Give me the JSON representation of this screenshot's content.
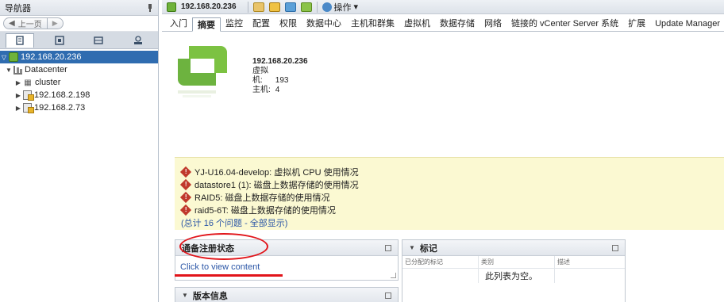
{
  "navigator": {
    "title": "导航器",
    "back_label": "上一页",
    "tree": {
      "root": "192.168.20.236",
      "datacenter": "Datacenter",
      "cluster": "cluster",
      "hosts": [
        "192.168.2.198",
        "192.168.2.73"
      ]
    }
  },
  "header": {
    "object": "192.168.20.236",
    "actions_label": "操作"
  },
  "tabs": [
    "入门",
    "摘要",
    "监控",
    "配置",
    "权限",
    "数据中心",
    "主机和群集",
    "虚拟机",
    "数据存储",
    "网络",
    "链接的 vCenter Server 系统",
    "扩展",
    "Update Manager"
  ],
  "summary": {
    "name": "192.168.20.236",
    "vm_label": "虚拟机:",
    "vm_count": "193",
    "host_label": "主机:",
    "host_count": "4"
  },
  "alerts": {
    "items": [
      "YJ-U16.04-develop: 虚拟机 CPU 使用情况",
      "datastore1 (1): 磁盘上数据存储的使用情况",
      "RAID5: 磁盘上数据存储的使用情况",
      "raid5-6T: 磁盘上数据存储的使用情况"
    ],
    "footer": "(总计 16 个问题 - 全部显示)"
  },
  "registration": {
    "title": "通备注册状态",
    "link": "Click to view content"
  },
  "tags": {
    "title": "标记",
    "columns": [
      "已分配的标记",
      "类别",
      "描述"
    ],
    "empty": "此列表为空。"
  },
  "version": {
    "title": "版本信息"
  },
  "colors": {
    "selection": "#2f6cb0",
    "alert_bg": "#fbf9d2",
    "link": "#2a55a6",
    "annotation": "#e1141a"
  }
}
